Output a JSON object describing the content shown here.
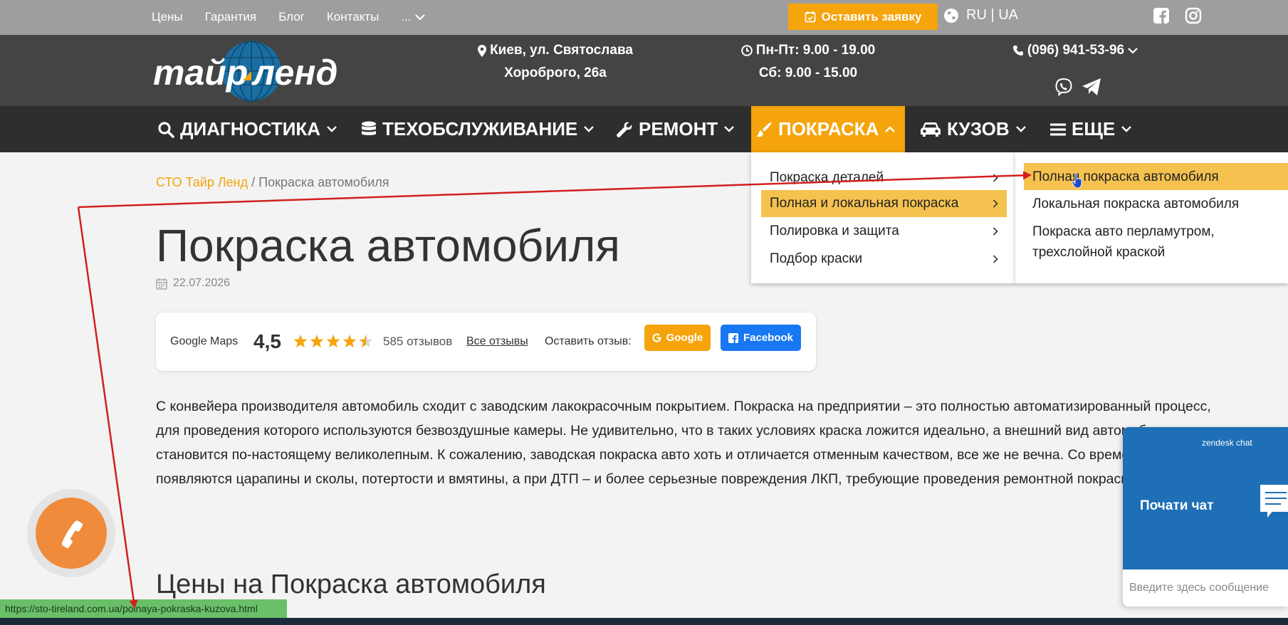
{
  "topbar": {
    "links": [
      "Цены",
      "Гарантия",
      "Блог",
      "Контакты"
    ],
    "more_label": "...",
    "request_button": "Оставить заявку",
    "language": "RU | UA"
  },
  "header": {
    "logo_text": "тайр ленд",
    "address_line1": "Киев, ул. Святослава",
    "address_line2": "Хороброго, 26а",
    "hours_line1": "Пн-Пт: 9.00 - 19.00",
    "hours_line2": "Сб: 9.00 - 15.00",
    "phone": "(096) 941-53-96"
  },
  "nav": {
    "items": [
      {
        "label": "ДИАГНОСТИКА",
        "icon": "search-icon"
      },
      {
        "label": "ТЕХОБСЛУЖИВАНИЕ",
        "icon": "database-icon"
      },
      {
        "label": "РЕМОНТ",
        "icon": "wrench-icon"
      },
      {
        "label": "ПОКРАСКА",
        "icon": "brush-icon"
      },
      {
        "label": "КУЗОВ",
        "icon": "car-icon"
      },
      {
        "label": "ЕЩЕ",
        "icon": "menu-icon"
      }
    ],
    "active_index": 3
  },
  "dropdown": {
    "items": [
      "Покраска деталей",
      "Полная и локальная покраска",
      "Полировка и защита",
      "Подбор краски"
    ],
    "highlighted_index": 1,
    "submenu": [
      "Полная покраска автомобиля",
      "Локальная покраска автомобиля",
      "Покраска авто перламутром, трехслойной краской"
    ],
    "submenu_highlighted_index": 0
  },
  "breadcrumb": {
    "home": "СТО Тайр Ленд",
    "separator": " / ",
    "current": "Покраска автомобиля"
  },
  "page": {
    "title": "Покраска автомобиля",
    "date": "22.07.2026",
    "paragraph": "С конвейера производителя автомобиль сходит с заводским лакокрасочным покрытием. Покраска на предприятии – это полностью автоматизированный процесс, для проведения которого используются безвоздушные камеры. Не удивительно, что в таких условиях краска ложится идеально, а внешний вид автомобиля становится по-настоящему великолепным. К сожалению, заводская покраска авто хоть и отличается отменным качеством, все же не вечна. Со временем на кузове появляются царапины и сколы, потертости и вмятины, а при ДТП – и более серьезные повреждения ЛКП, требующие проведения ремонтной покраски.",
    "section_title": "Цены на Покраска автомобиля"
  },
  "reviews": {
    "source": "Google Maps",
    "rating": "4,5",
    "rating_value": 4.5,
    "count_text": "585 отзывов",
    "all_link": "Все отзывы",
    "leave_label": "Оставить отзыв:",
    "google_btn": "Google",
    "facebook_btn": "Facebook"
  },
  "chat": {
    "brand": "zendesk chat",
    "start_label": "Почати чат",
    "input_placeholder": "Введите здесь сообщение"
  },
  "status_url": "https://sto-tireland.com.ua/polnaya-pokraska-kuzova.html",
  "colors": {
    "accent": "#f5a40c",
    "highlight": "#f5c24f",
    "header_bg": "#444444",
    "nav_bg": "#2e2e2e",
    "facebook": "#1877f2",
    "zendesk": "#1e6fb5",
    "annotation_arrow": "#d21f1f"
  }
}
